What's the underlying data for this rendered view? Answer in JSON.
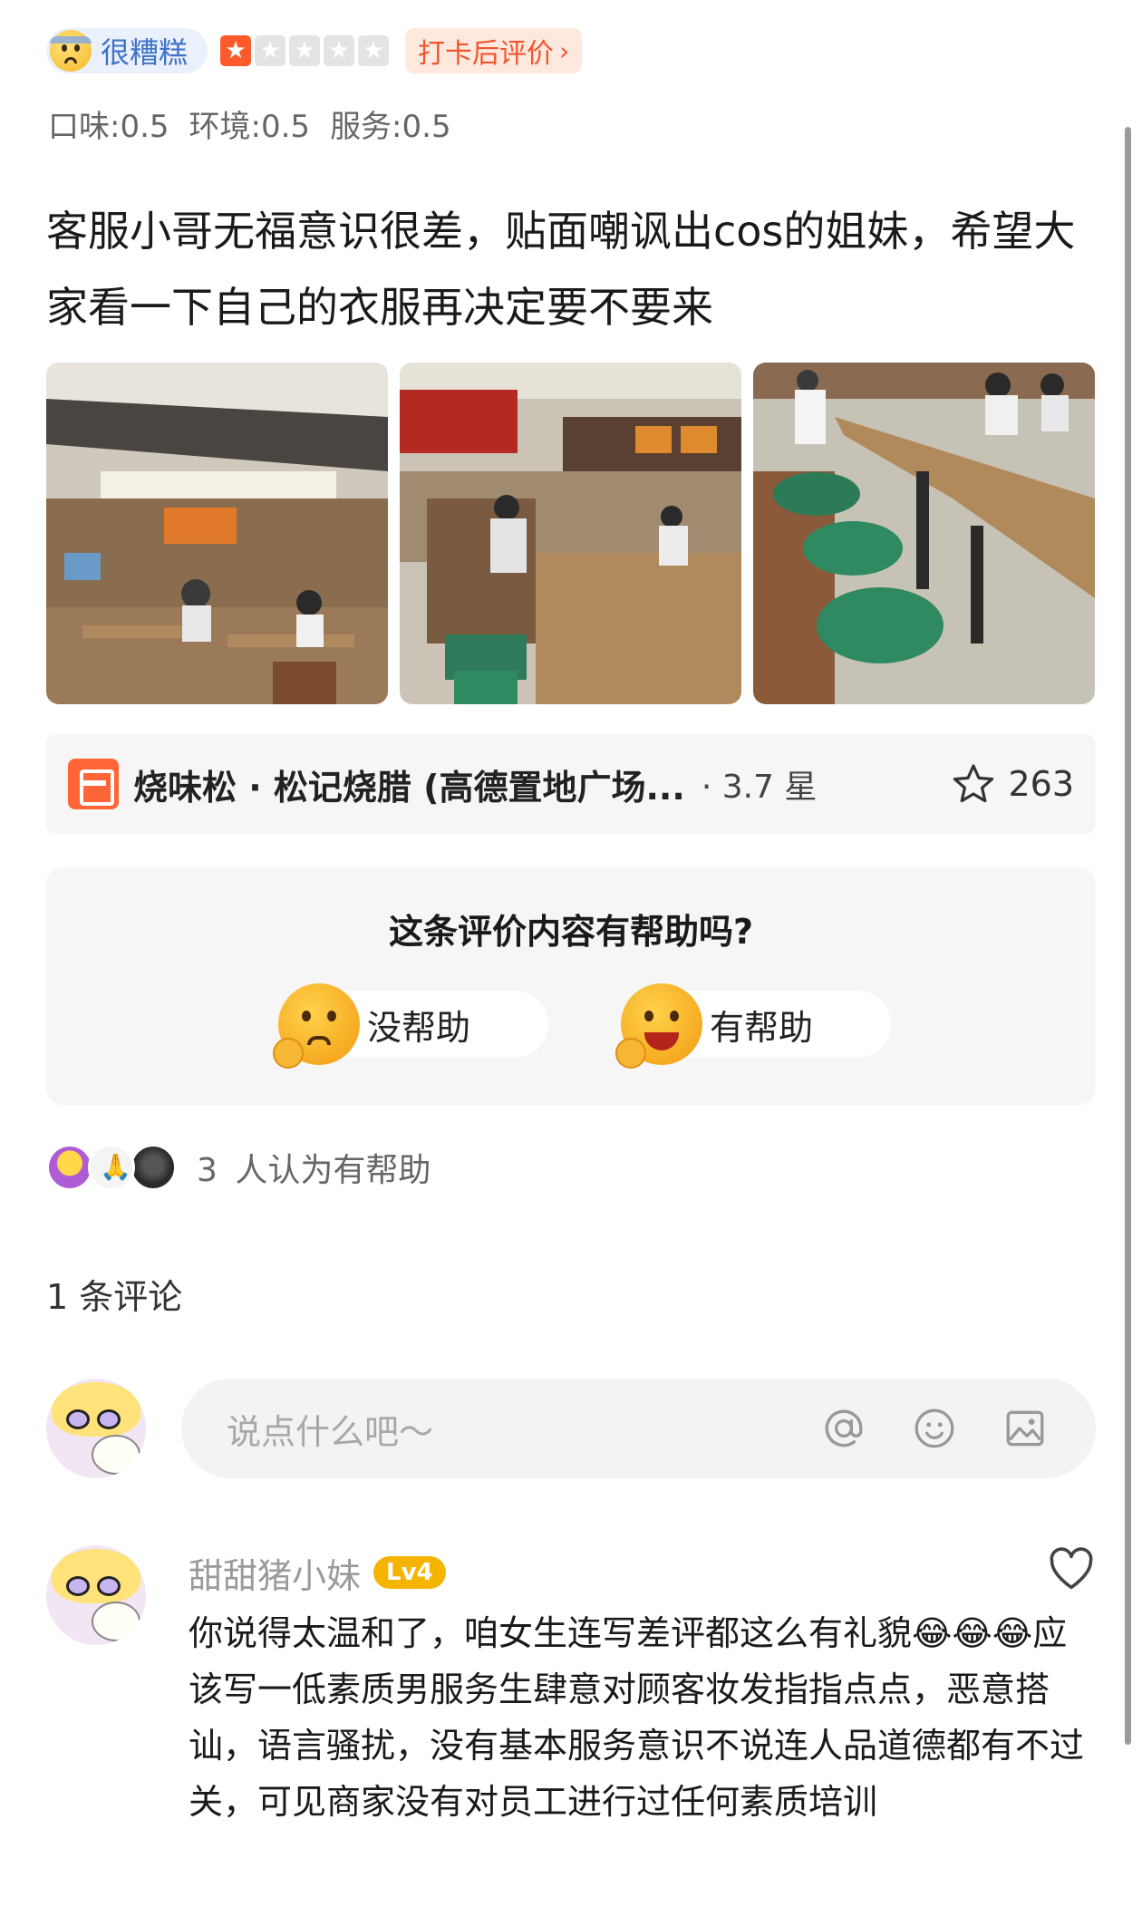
{
  "review": {
    "mood_label": "很糟糕",
    "star_rating": 1,
    "star_max": 5,
    "checkin_label": "打卡后评价",
    "scores": [
      "口味:0.5",
      "环境:0.5",
      "服务:0.5"
    ],
    "text": "客服小哥无福意识很差，贴面嘲讽出cos的姐妹，希望大家看一下自己的衣服再决定要不要来",
    "photos": [
      "restaurant-entrance-photo",
      "dining-hall-photo",
      "green-chairs-photo"
    ]
  },
  "shop": {
    "icon": "shop-icon",
    "name": "烧味松 · 松记烧腊 (高德置地广场...",
    "rating": "· 3.7 星",
    "favorite_icon": "star-outline-icon",
    "favorite_count": "263"
  },
  "helpful": {
    "question": "这条评价内容有帮助吗?",
    "no_label": "没帮助",
    "yes_label": "有帮助",
    "helped_count": "3",
    "helped_text": "人认为有帮助"
  },
  "comments": {
    "count_label": "1 条评论",
    "input_placeholder": "说点什么吧～",
    "input_icons": [
      "at-icon",
      "emoji-icon",
      "image-icon"
    ],
    "items": [
      {
        "user": "甜甜猪小妹",
        "level": "Lv4",
        "text": "你说得太温和了，咱女生连写差评都这么有礼貌😂😂😂应该写一低素质男服务生肆意对顾客妆发指指点点，恶意搭讪，语言骚扰，没有基本服务意识不说连人品道德都有不过关，可见商家没有对员工进行过任何素质培训"
      }
    ]
  },
  "colors": {
    "accent": "#ff5a2b",
    "mood_blue": "#3f72c9",
    "level_badge": "#f5b400"
  }
}
